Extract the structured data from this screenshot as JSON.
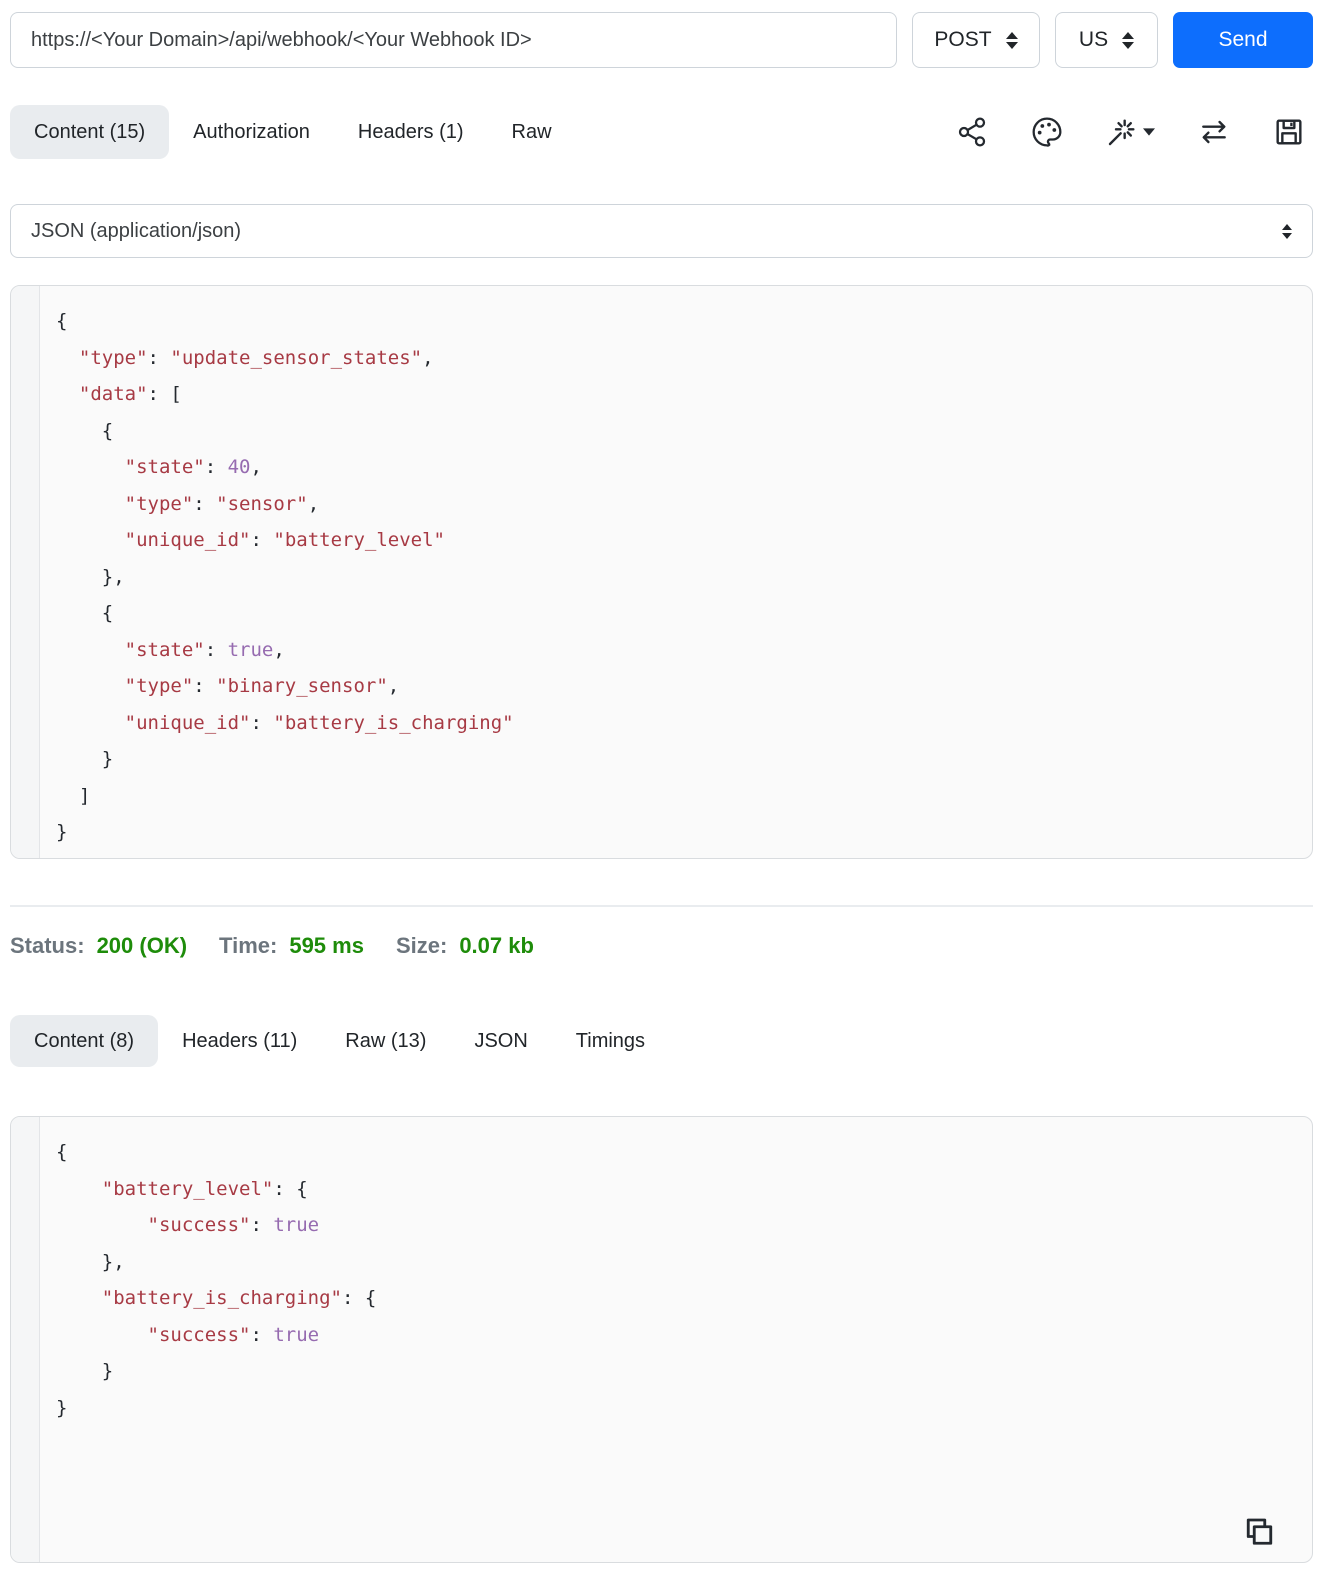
{
  "colors": {
    "accent": "#0d6efd",
    "success": "#1e8c0a",
    "label-gray": "#6c757d",
    "string": "#a73a44",
    "atom": "#966bb0",
    "punct": "#24292f",
    "tab-bg": "#e9ecef"
  },
  "toolbar": {
    "url": "https://<Your Domain>/api/webhook/<Your Webhook ID>",
    "method": "POST",
    "locale": "US",
    "send_label": "Send",
    "icons": [
      "share-icon",
      "palette-icon",
      "magic-wand-icon",
      "swap-icon",
      "save-icon"
    ]
  },
  "request": {
    "tabs": [
      {
        "label": "Content (15)",
        "active": true
      },
      {
        "label": "Authorization",
        "active": false
      },
      {
        "label": "Headers (1)",
        "active": false
      },
      {
        "label": "Raw",
        "active": false
      }
    ],
    "body_type_selected": "JSON (application/json)",
    "body_lines": [
      [
        [
          "{",
          "p"
        ]
      ],
      [
        [
          "  ",
          "p"
        ],
        [
          "\"type\"",
          "s"
        ],
        [
          ": ",
          "p"
        ],
        [
          "\"update_sensor_states\"",
          "s"
        ],
        [
          ",",
          "p"
        ]
      ],
      [
        [
          "  ",
          "p"
        ],
        [
          "\"data\"",
          "s"
        ],
        [
          ": [",
          "p"
        ]
      ],
      [
        [
          "    {",
          "p"
        ]
      ],
      [
        [
          "      ",
          "p"
        ],
        [
          "\"state\"",
          "s"
        ],
        [
          ": ",
          "p"
        ],
        [
          "40",
          "a"
        ],
        [
          ",",
          "p"
        ]
      ],
      [
        [
          "      ",
          "p"
        ],
        [
          "\"type\"",
          "s"
        ],
        [
          ": ",
          "p"
        ],
        [
          "\"sensor\"",
          "s"
        ],
        [
          ",",
          "p"
        ]
      ],
      [
        [
          "      ",
          "p"
        ],
        [
          "\"unique_id\"",
          "s"
        ],
        [
          ": ",
          "p"
        ],
        [
          "\"battery_level\"",
          "s"
        ]
      ],
      [
        [
          "    },",
          "p"
        ]
      ],
      [
        [
          "    {",
          "p"
        ]
      ],
      [
        [
          "      ",
          "p"
        ],
        [
          "\"state\"",
          "s"
        ],
        [
          ": ",
          "p"
        ],
        [
          "true",
          "a"
        ],
        [
          ",",
          "p"
        ]
      ],
      [
        [
          "      ",
          "p"
        ],
        [
          "\"type\"",
          "s"
        ],
        [
          ": ",
          "p"
        ],
        [
          "\"binary_sensor\"",
          "s"
        ],
        [
          ",",
          "p"
        ]
      ],
      [
        [
          "      ",
          "p"
        ],
        [
          "\"unique_id\"",
          "s"
        ],
        [
          ": ",
          "p"
        ],
        [
          "\"battery_is_charging\"",
          "s"
        ]
      ],
      [
        [
          "    }",
          "p"
        ]
      ],
      [
        [
          "  ]",
          "p"
        ]
      ],
      [
        [
          "}",
          "p"
        ]
      ]
    ]
  },
  "response": {
    "status_label": "Status:",
    "status_value": "200 (OK)",
    "time_label": "Time:",
    "time_value": "595 ms",
    "size_label": "Size:",
    "size_value": "0.07 kb",
    "tabs": [
      {
        "label": "Content (8)",
        "active": true
      },
      {
        "label": "Headers (11)",
        "active": false
      },
      {
        "label": "Raw (13)",
        "active": false
      },
      {
        "label": "JSON",
        "active": false
      },
      {
        "label": "Timings",
        "active": false
      }
    ],
    "copy_icon": "copy-icon",
    "body_lines": [
      [
        [
          "{",
          "p"
        ]
      ],
      [
        [
          "    ",
          "p"
        ],
        [
          "\"battery_level\"",
          "s"
        ],
        [
          ": {",
          "p"
        ]
      ],
      [
        [
          "        ",
          "p"
        ],
        [
          "\"success\"",
          "s"
        ],
        [
          ": ",
          "p"
        ],
        [
          "true",
          "a"
        ]
      ],
      [
        [
          "    },",
          "p"
        ]
      ],
      [
        [
          "    ",
          "p"
        ],
        [
          "\"battery_is_charging\"",
          "s"
        ],
        [
          ": {",
          "p"
        ]
      ],
      [
        [
          "        ",
          "p"
        ],
        [
          "\"success\"",
          "s"
        ],
        [
          ": ",
          "p"
        ],
        [
          "true",
          "a"
        ]
      ],
      [
        [
          "    }",
          "p"
        ]
      ],
      [
        [
          "}",
          "p"
        ]
      ]
    ]
  }
}
